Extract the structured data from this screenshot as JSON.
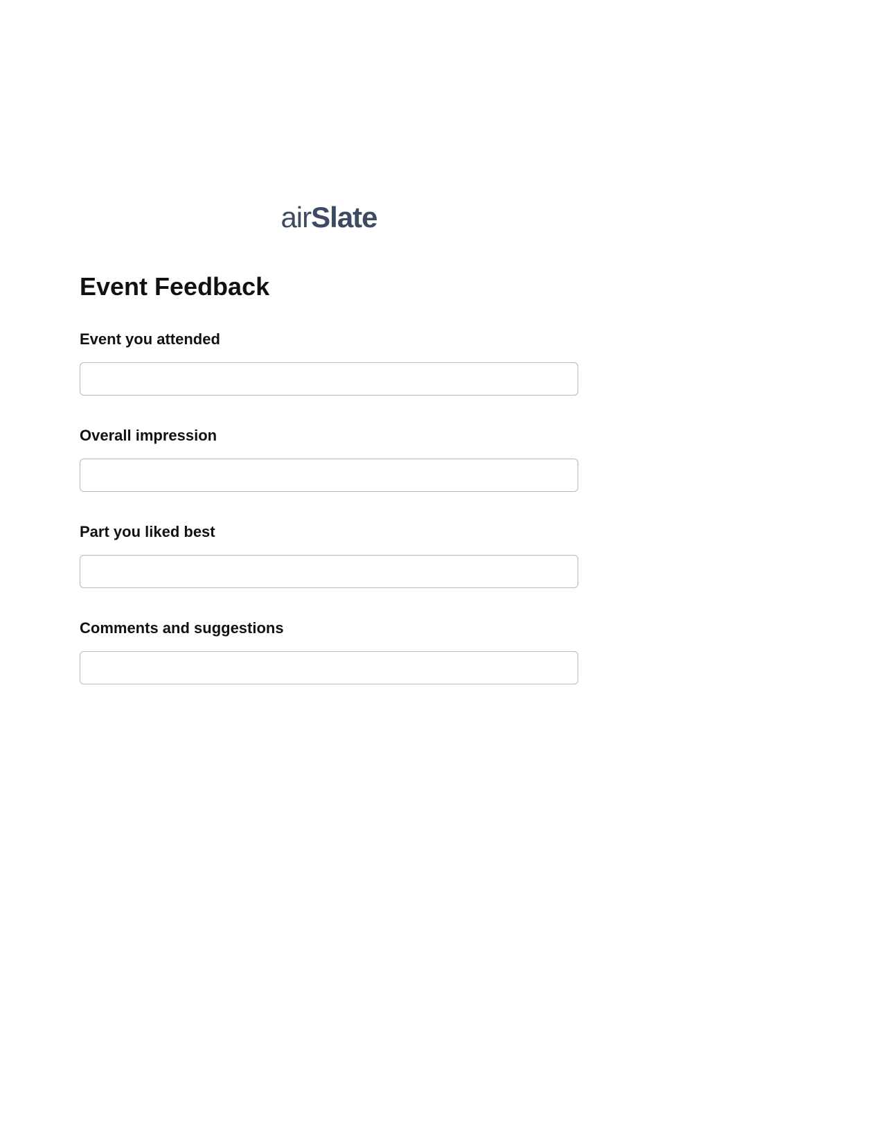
{
  "logo": {
    "part1": "air",
    "part2": "Slate"
  },
  "title": "Event Feedback",
  "fields": [
    {
      "label": "Event you attended",
      "value": ""
    },
    {
      "label": "Overall impression",
      "value": ""
    },
    {
      "label": "Part you liked best",
      "value": ""
    },
    {
      "label": "Comments and suggestions",
      "value": ""
    }
  ]
}
